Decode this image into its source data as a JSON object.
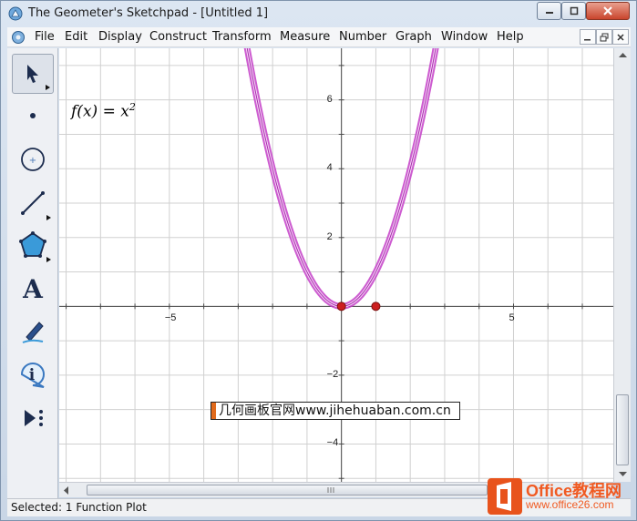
{
  "window": {
    "title": "The Geometer's Sketchpad - [Untitled 1]"
  },
  "menu": {
    "items": [
      "File",
      "Edit",
      "Display",
      "Construct",
      "Transform",
      "Measure",
      "Number",
      "Graph",
      "Window",
      "Help"
    ]
  },
  "toolbox": {
    "tools": [
      {
        "name": "arrow-select-tool",
        "icon": "arrow-icon"
      },
      {
        "name": "point-tool",
        "icon": "point-icon"
      },
      {
        "name": "compass-tool",
        "icon": "compass-icon"
      },
      {
        "name": "straightedge-tool",
        "icon": "straightedge-icon"
      },
      {
        "name": "polygon-tool",
        "icon": "polygon-icon"
      },
      {
        "name": "text-tool",
        "icon": "text-A-icon",
        "glyph": "A"
      },
      {
        "name": "marker-tool",
        "icon": "marker-icon"
      },
      {
        "name": "information-tool",
        "icon": "info-icon",
        "glyph": "i"
      },
      {
        "name": "custom-tool",
        "icon": "custom-tools-icon"
      }
    ]
  },
  "sketch": {
    "function_label": {
      "name": "f",
      "var": "x",
      "rhs_base": "x",
      "rhs_exp": "2"
    },
    "x_ticks": [
      {
        "value": -5,
        "label": "−5"
      },
      {
        "value": 5,
        "label": "5"
      }
    ],
    "y_ticks": [
      {
        "value": 6,
        "label": "6"
      },
      {
        "value": 4,
        "label": "4"
      },
      {
        "value": 2,
        "label": "2"
      },
      {
        "value": -2,
        "label": "−2"
      },
      {
        "value": -4,
        "label": "−4"
      }
    ],
    "points": [
      {
        "x": 0,
        "y": 0
      },
      {
        "x": 1,
        "y": 0
      }
    ],
    "curve_color": "#c43fc8",
    "point_color": "#cc1f1f"
  },
  "chart_data": {
    "type": "line",
    "x_range": [
      -8.2,
      7.9
    ],
    "y_range": [
      -5.1,
      7.5
    ],
    "grid": true,
    "series": [
      {
        "function": "x^2",
        "x_from": -2.8,
        "x_to": 2.8
      }
    ]
  },
  "overlay": {
    "watermark": "几何画板官网www.jihehuaban.com.cn"
  },
  "status": {
    "text": "Selected: 1 Function Plot"
  },
  "branding": {
    "office_title": "Office教程网",
    "office_url": "www.office26.com",
    "accent": "#f05a22"
  }
}
